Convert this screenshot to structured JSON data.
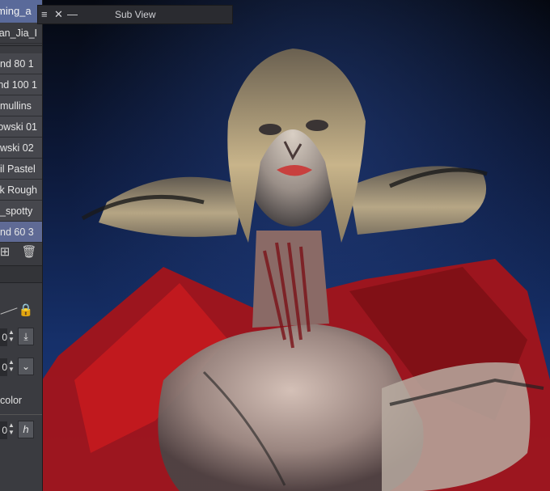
{
  "brush_panel": {
    "active_tab": "ming_a",
    "items": [
      {
        "label": "uan_Jia_I"
      },
      {
        "label": "nd 80 1"
      },
      {
        "label": "nd 100 1"
      },
      {
        "label": "mullins"
      },
      {
        "label": "owski 01"
      },
      {
        "label": "wski 02"
      },
      {
        "label": "il Pastel"
      },
      {
        "label": "k Rough"
      },
      {
        "label": "_spotty"
      },
      {
        "label": "nd 60 3"
      }
    ],
    "selected_index": 9
  },
  "tool_property": {
    "value_1": "0",
    "value_2": "0",
    "color_label": "color",
    "value_3": "0"
  },
  "sub_view": {
    "title": "Sub View",
    "menu_icon": "≡",
    "close_icon": "✕",
    "minimize_icon": "—"
  }
}
